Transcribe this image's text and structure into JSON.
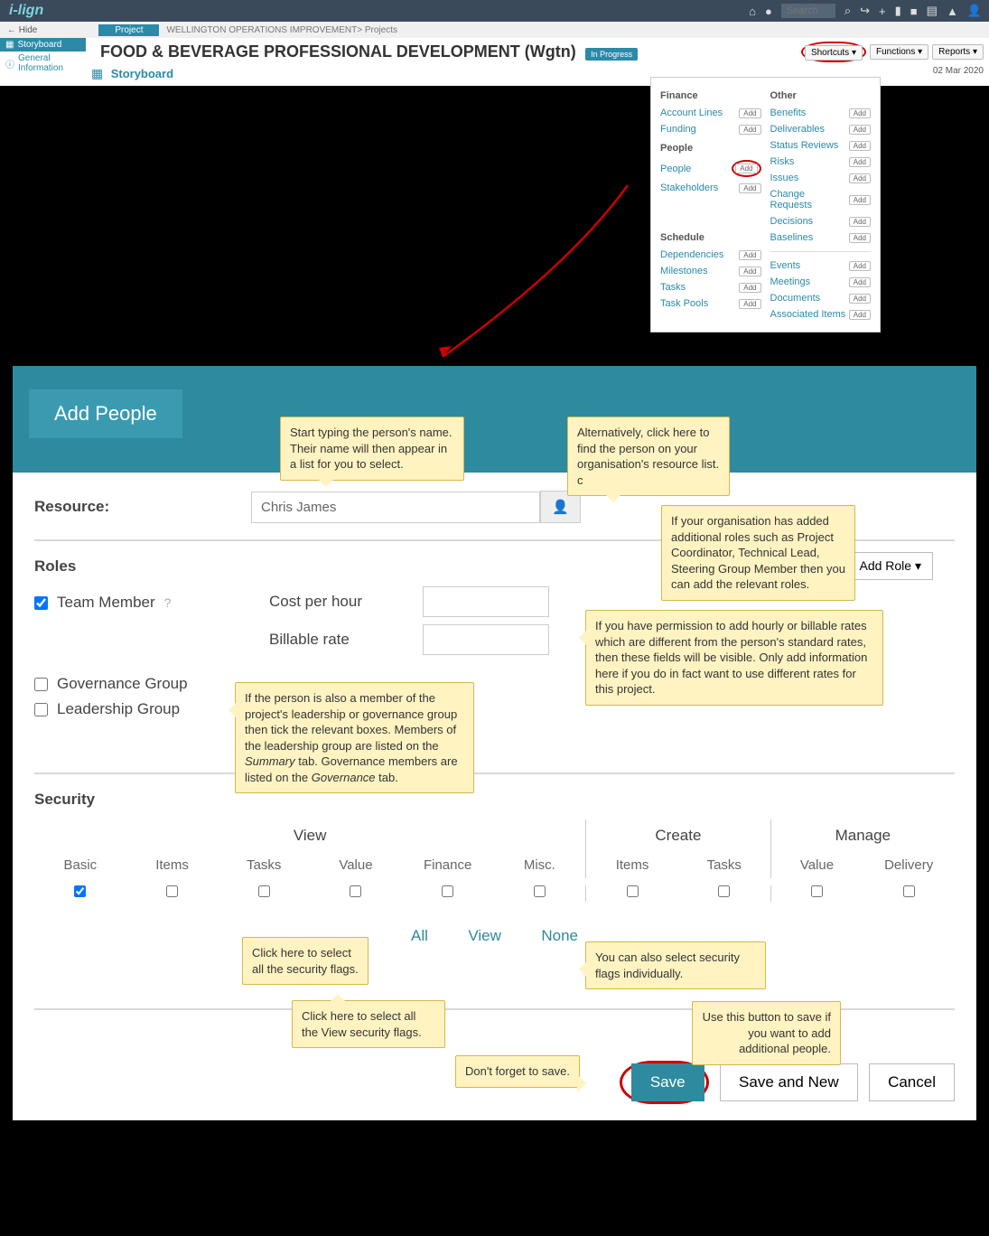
{
  "topbar": {
    "logo": "i-lign",
    "search_placeholder": "Search"
  },
  "hidebar": {
    "hide": "Hide",
    "tab": "Project",
    "crumb": "WELLINGTON OPERATIONS IMPROVEMENT> Projects"
  },
  "nav": {
    "storyboard": "Storyboard",
    "geninfo": "General Information"
  },
  "header": {
    "title": "FOOD & BEVERAGE PROFESSIONAL DEVELOPMENT (Wgtn)",
    "status": "In Progress",
    "shortcuts": "Shortcuts",
    "functions": "Functions",
    "reports": "Reports",
    "date": "02 Mar 2020",
    "sb_icon_label": "Storyboard"
  },
  "shortcuts": {
    "finance_h": "Finance",
    "people_h": "People",
    "schedule_h": "Schedule",
    "other_h": "Other",
    "add": "Add",
    "account_lines": "Account Lines",
    "funding": "Funding",
    "people": "People",
    "stakeholders": "Stakeholders",
    "dependencies": "Dependencies",
    "milestones": "Milestones",
    "tasks": "Tasks",
    "task_pools": "Task Pools",
    "benefits": "Benefits",
    "deliverables": "Deliverables",
    "status_reviews": "Status Reviews",
    "risks": "Risks",
    "issues": "Issues",
    "change_requests": "Change Requests",
    "decisions": "Decisions",
    "baselines": "Baselines",
    "events": "Events",
    "meetings": "Meetings",
    "documents": "Documents",
    "assoc_items": "Associated Items"
  },
  "form": {
    "title": "Add People",
    "resource_lbl": "Resource:",
    "resource_val": "Chris James",
    "roles_h": "Roles",
    "add_role": "Add Role",
    "team_member": "Team Member",
    "cost_lbl": "Cost per hour",
    "billable_lbl": "Billable rate",
    "gov_group": "Governance Group",
    "lead_group": "Leadership Group",
    "security_h": "Security",
    "grp_view": "View",
    "grp_create": "Create",
    "grp_manage": "Manage",
    "c_basic": "Basic",
    "c_items": "Items",
    "c_tasks": "Tasks",
    "c_value": "Value",
    "c_finance": "Finance",
    "c_misc": "Misc.",
    "c_delivery": "Delivery",
    "lnk_all": "All",
    "lnk_view": "View",
    "lnk_none": "None",
    "btn_save": "Save",
    "btn_save_new": "Save and New",
    "btn_cancel": "Cancel"
  },
  "callouts": {
    "c1": "Start typing the person's name. Their name will then appear in a list for you to select.",
    "c2": "Alternatively, click here to find the person on your organisation's resource list. c",
    "c3": "If your organisation has added additional roles such as Project Coordinator, Technical Lead, Steering Group Member then you can add the relevant roles.",
    "c4": "If you have permission to add hourly or billable rates which are different from the person's standard rates, then these fields will be visible. Only add information here if you do in fact want to use different rates for this project.",
    "c5a": "If the person is also a member of the project's leadership or governance group then tick the relevant boxes.  Members of the leadership group are listed on the ",
    "c5b": "Summary",
    "c5c": " tab. Governance members are listed on the ",
    "c5d": "Governance",
    "c5e": " tab.",
    "c6": "Click here to select all the security flags.",
    "c7": "Click here to select all the View security flags.",
    "c8": "You can also select security flags individually.",
    "c9": "Use this button to save if you want to add additional people.",
    "c10": "Don't forget to save."
  }
}
